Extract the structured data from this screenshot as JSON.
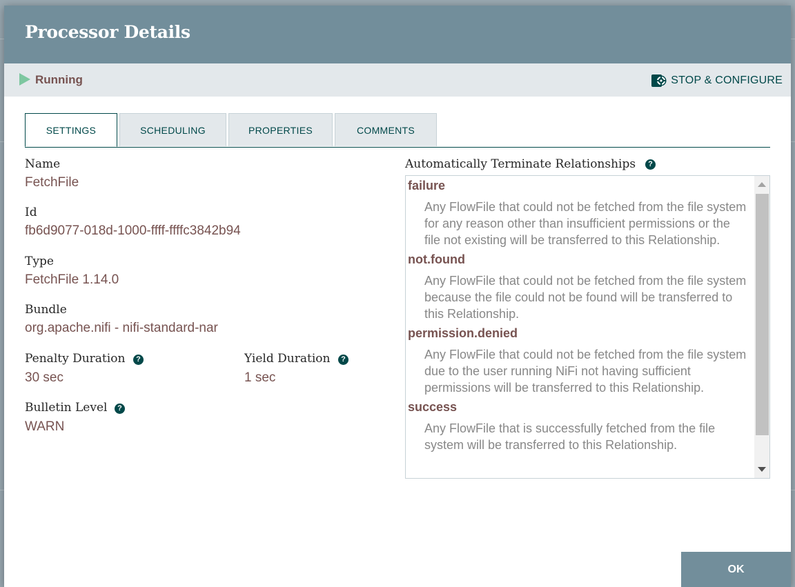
{
  "dialog": {
    "title": "Processor Details",
    "status": "Running",
    "stop_configure_label": "STOP & CONFIGURE",
    "ok_label": "OK"
  },
  "tabs": [
    {
      "label": "SETTINGS",
      "active": true
    },
    {
      "label": "SCHEDULING",
      "active": false
    },
    {
      "label": "PROPERTIES",
      "active": false
    },
    {
      "label": "COMMENTS",
      "active": false
    }
  ],
  "settings": {
    "name_label": "Name",
    "name_value": "FetchFile",
    "id_label": "Id",
    "id_value": "fb6d9077-018d-1000-ffff-ffffc3842b94",
    "type_label": "Type",
    "type_value": "FetchFile 1.14.0",
    "bundle_label": "Bundle",
    "bundle_value": "org.apache.nifi - nifi-standard-nar",
    "penalty_label": "Penalty Duration",
    "penalty_value": "30 sec",
    "yield_label": "Yield Duration",
    "yield_value": "1 sec",
    "bulletin_label": "Bulletin Level",
    "bulletin_value": "WARN"
  },
  "relationships": {
    "header": "Automatically Terminate Relationships",
    "items": [
      {
        "name": "failure",
        "description": "Any FlowFile that could not be fetched from the file system for any reason other than insufficient permissions or the file not existing will be transferred to this Relationship."
      },
      {
        "name": "not.found",
        "description": "Any FlowFile that could not be fetched from the file system because the file could not be found will be transferred to this Relationship."
      },
      {
        "name": "permission.denied",
        "description": "Any FlowFile that could not be fetched from the file system due to the user running NiFi not having sufficient permissions will be transferred to this Relationship."
      },
      {
        "name": "success",
        "description": "Any FlowFile that is successfully fetched from the file system will be transferred to this Relationship."
      }
    ]
  },
  "colors": {
    "header_bg": "#728e9b",
    "accent": "#004849",
    "value_text": "#775351",
    "running_icon": "#7dc7a0"
  }
}
